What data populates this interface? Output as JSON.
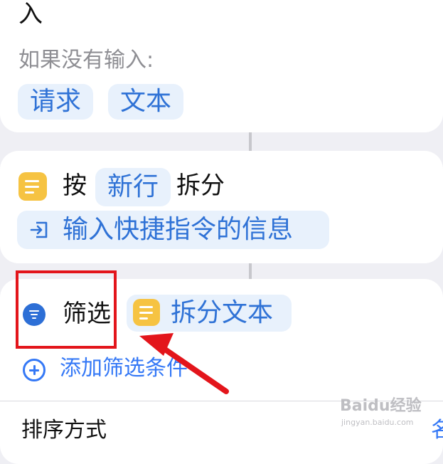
{
  "top_card": {
    "partial_title": "入",
    "if_no_input_label": "如果没有输入:",
    "tokens": [
      "请求",
      "文本"
    ]
  },
  "split_action": {
    "verb": "按",
    "separator_token": "新行",
    "suffix": "拆分",
    "input_token": "输入快捷指令的信息"
  },
  "filter_action": {
    "label": "筛选",
    "input_token": "拆分文本",
    "add_condition": "添加筛选条件"
  },
  "sort": {
    "label": "排序方式",
    "value_partial": "名"
  },
  "watermark": {
    "brand": "Baidu经验",
    "url": "jingyan.baidu.com"
  },
  "colors": {
    "accent_blue": "#2f72d6",
    "token_bg": "#e8f1fc",
    "icon_yellow": "#f6c342",
    "highlight_red": "#e3151b"
  }
}
